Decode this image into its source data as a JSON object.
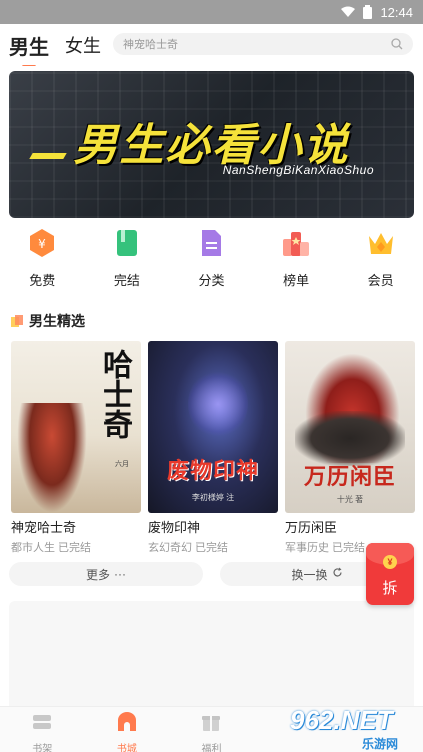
{
  "status_bar": {
    "time": "12:44"
  },
  "header": {
    "tabs": [
      {
        "label": "男生",
        "active": true
      },
      {
        "label": "女生",
        "active": false
      }
    ],
    "search_placeholder": "神宠哈士奇"
  },
  "banner": {
    "title": "男生必看小说",
    "subtitle": "NanShengBiKanXiaoShuo"
  },
  "quick_nav": [
    {
      "label": "免费",
      "icon": "coin-badge-icon",
      "color": "#ff8a3d"
    },
    {
      "label": "完结",
      "icon": "book-icon",
      "color": "#35c27c"
    },
    {
      "label": "分类",
      "icon": "document-icon",
      "color": "#9c6ade"
    },
    {
      "label": "榜单",
      "icon": "ranking-icon",
      "color": "#f25c54"
    },
    {
      "label": "会员",
      "icon": "crown-icon",
      "color": "#ffbe2e"
    }
  ],
  "section": {
    "title": "男生精选"
  },
  "books": [
    {
      "name": "神宠哈士奇",
      "meta": "都市人生 已完结",
      "cover_title": "哈士奇",
      "cover_author": "六月"
    },
    {
      "name": "废物印神",
      "meta": "玄幻奇幻 已完结",
      "cover_title": "废物印神",
      "cover_author": "李初様婷 注"
    },
    {
      "name": "万历闲臣",
      "meta": "军事历史 已完结",
      "cover_title": "万历闲臣",
      "cover_author": "十光 著"
    }
  ],
  "buttons": {
    "more": "更多",
    "refresh": "换一换"
  },
  "float": {
    "label": "拆",
    "coin": "¥"
  },
  "bottom_nav": [
    {
      "label": "书架",
      "icon": "bookshelf-icon",
      "active": false
    },
    {
      "label": "书城",
      "icon": "bookstore-icon",
      "active": true
    },
    {
      "label": "福利",
      "icon": "gift-icon",
      "active": false
    }
  ],
  "watermark": {
    "big": "962.NET",
    "small": "乐游网"
  },
  "colors": {
    "accent": "#ff7a4d",
    "banner_text": "#f5e23a",
    "envelope": "#f03a3a"
  }
}
